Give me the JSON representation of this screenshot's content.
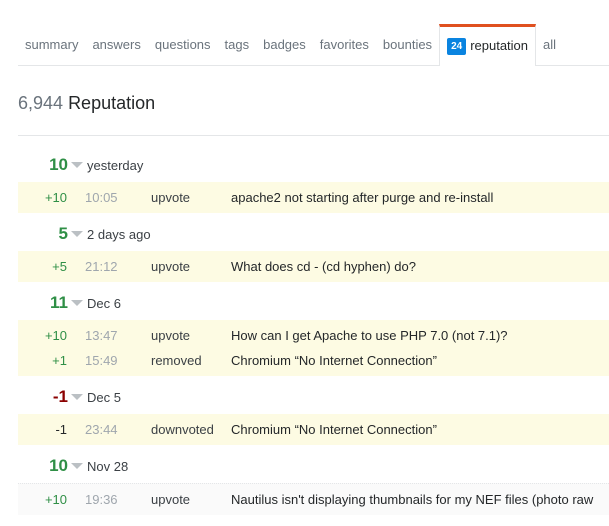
{
  "tabs": [
    {
      "label": "summary"
    },
    {
      "label": "answers"
    },
    {
      "label": "questions"
    },
    {
      "label": "tags"
    },
    {
      "label": "badges"
    },
    {
      "label": "favorites"
    },
    {
      "label": "bounties"
    },
    {
      "label": "reputation",
      "badge": "24",
      "active": true
    },
    {
      "label": "all"
    }
  ],
  "header": {
    "count": "6,944",
    "label": "Reputation"
  },
  "colors": {
    "positive": "#2f8f46",
    "negative": "#8b0000",
    "accent": "#e0501f",
    "badge": "#0a84e0"
  },
  "groups": [
    {
      "total": "10",
      "date": "yesterday",
      "sign": "pos",
      "rows": [
        {
          "amount": "+10",
          "time": "10:05",
          "action": "upvote",
          "title": "apache2 not starting after purge and re-install"
        }
      ]
    },
    {
      "total": "5",
      "date": "2 days ago",
      "sign": "pos",
      "rows": [
        {
          "amount": "+5",
          "time": "21:12",
          "action": "upvote",
          "title": "What does cd - (cd hyphen) do?"
        }
      ]
    },
    {
      "total": "11",
      "date": "Dec 6",
      "sign": "pos",
      "rows": [
        {
          "amount": "+10",
          "time": "13:47",
          "action": "upvote",
          "title": "How can I get Apache to use PHP 7.0 (not 7.1)?"
        },
        {
          "amount": "+1",
          "time": "15:49",
          "action": "removed",
          "title": "Chromium “No Internet Connection”"
        }
      ]
    },
    {
      "total": "-1",
      "date": "Dec 5",
      "sign": "neg",
      "rows": [
        {
          "amount": "-1",
          "time": "23:44",
          "action": "downvoted",
          "title": "Chromium “No Internet Connection”"
        }
      ]
    },
    {
      "total": "10",
      "date": "Nov 28",
      "sign": "pos",
      "gray": true,
      "rows": [
        {
          "amount": "+10",
          "time": "19:36",
          "action": "upvote",
          "title": "Nautilus isn't displaying thumbnails for my NEF files (photo raw"
        }
      ]
    }
  ]
}
